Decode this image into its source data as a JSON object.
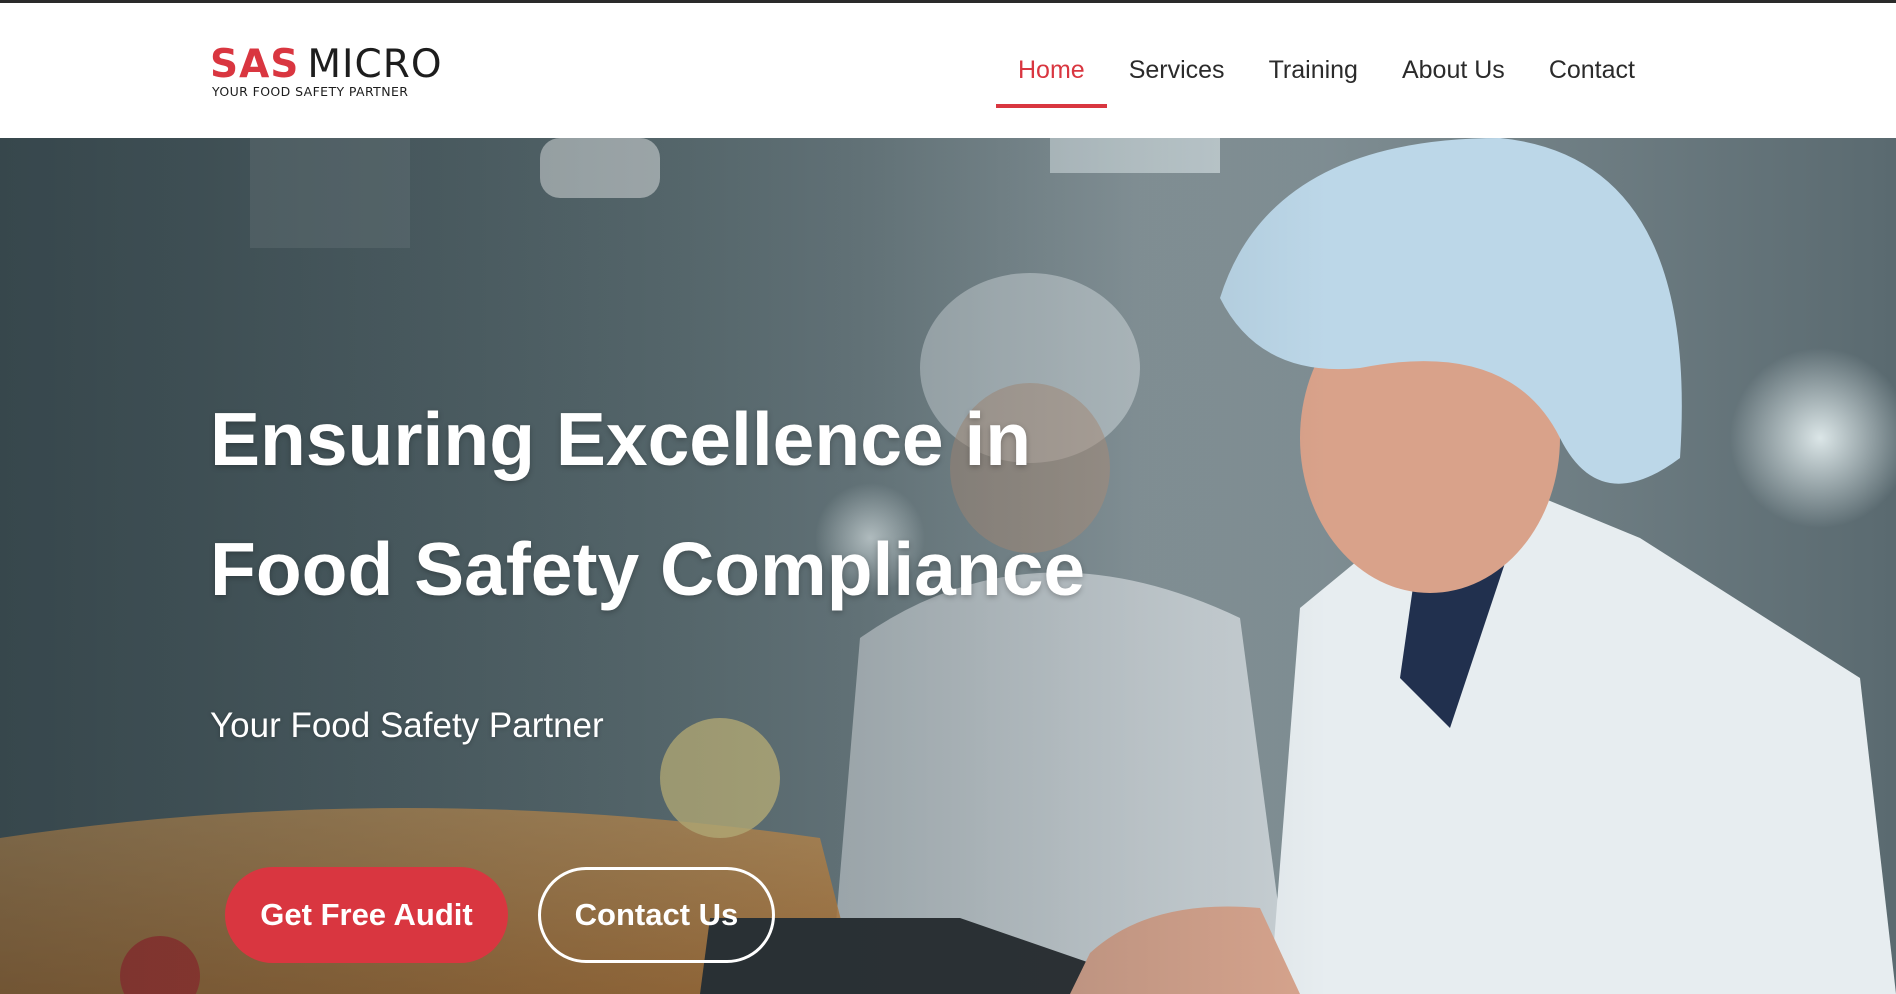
{
  "brand": {
    "name_primary": "SAS",
    "name_secondary": "MICRO",
    "tagline": "YOUR FOOD SAFETY PARTNER",
    "accent_color": "#d93640"
  },
  "nav": {
    "items": [
      {
        "label": "Home",
        "active": true
      },
      {
        "label": "Services",
        "active": false
      },
      {
        "label": "Training",
        "active": false
      },
      {
        "label": "About Us",
        "active": false
      },
      {
        "label": "Contact",
        "active": false
      }
    ]
  },
  "hero": {
    "title_line1": "Ensuring Excellence in",
    "title_line2": "Food Safety Compliance",
    "subtitle": "Your Food Safety Partner",
    "primary_cta": "Get Free Audit",
    "secondary_cta": "Contact Us",
    "image_subject": "food-safety-inspector-photo"
  }
}
